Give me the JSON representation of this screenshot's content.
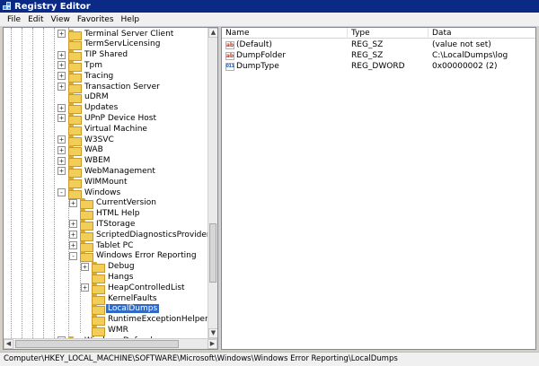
{
  "window": {
    "title": "Registry Editor"
  },
  "menu": [
    "File",
    "Edit",
    "View",
    "Favorites",
    "Help"
  ],
  "tree": {
    "nodes": [
      {
        "label": "Terminal Server Client",
        "expander": "+"
      },
      {
        "label": "TermServLicensing",
        "expander": ""
      },
      {
        "label": "TIP Shared",
        "expander": "+"
      },
      {
        "label": "Tpm",
        "expander": "+"
      },
      {
        "label": "Tracing",
        "expander": "+"
      },
      {
        "label": "Transaction Server",
        "expander": "+"
      },
      {
        "label": "uDRM",
        "expander": ""
      },
      {
        "label": "Updates",
        "expander": "+"
      },
      {
        "label": "UPnP Device Host",
        "expander": "+"
      },
      {
        "label": "Virtual Machine",
        "expander": ""
      },
      {
        "label": "W3SVC",
        "expander": "+"
      },
      {
        "label": "WAB",
        "expander": "+"
      },
      {
        "label": "WBEM",
        "expander": "+"
      },
      {
        "label": "WebManagement",
        "expander": "+"
      },
      {
        "label": "WIMMount",
        "expander": ""
      },
      {
        "label": "Windows",
        "expander": "-"
      },
      {
        "label": "CurrentVersion",
        "expander": "+"
      },
      {
        "label": "HTML Help",
        "expander": ""
      },
      {
        "label": "ITStorage",
        "expander": "+"
      },
      {
        "label": "ScriptedDiagnosticsProvider",
        "expander": "+"
      },
      {
        "label": "Tablet PC",
        "expander": "+"
      },
      {
        "label": "Windows Error Reporting",
        "expander": "-"
      },
      {
        "label": "Debug",
        "expander": "+"
      },
      {
        "label": "Hangs",
        "expander": ""
      },
      {
        "label": "HeapControlledList",
        "expander": "+"
      },
      {
        "label": "KernelFaults",
        "expander": ""
      },
      {
        "label": "LocalDumps",
        "expander": "",
        "selected": true
      },
      {
        "label": "RuntimeExceptionHelperModu",
        "expander": ""
      },
      {
        "label": "WMR",
        "expander": ""
      },
      {
        "label": "Windows Defender",
        "expander": "+"
      }
    ]
  },
  "values": {
    "columns": [
      "Name",
      "Type",
      "Data"
    ],
    "rows": [
      {
        "icon": "string-value-icon",
        "name": "(Default)",
        "type": "REG_SZ",
        "data": "(value not set)"
      },
      {
        "icon": "string-value-icon",
        "name": "DumpFolder",
        "type": "REG_SZ",
        "data": "C:\\LocalDumps\\log"
      },
      {
        "icon": "binary-value-icon",
        "name": "DumpType",
        "type": "REG_DWORD",
        "data": "0x00000002 (2)"
      }
    ]
  },
  "status": {
    "path": "Computer\\HKEY_LOCAL_MACHINE\\SOFTWARE\\Microsoft\\Windows\\Windows Error Reporting\\LocalDumps"
  },
  "colors": {
    "titlebar": "#0b2a86",
    "selection": "#316ac5",
    "folder": "#f2cd57"
  }
}
